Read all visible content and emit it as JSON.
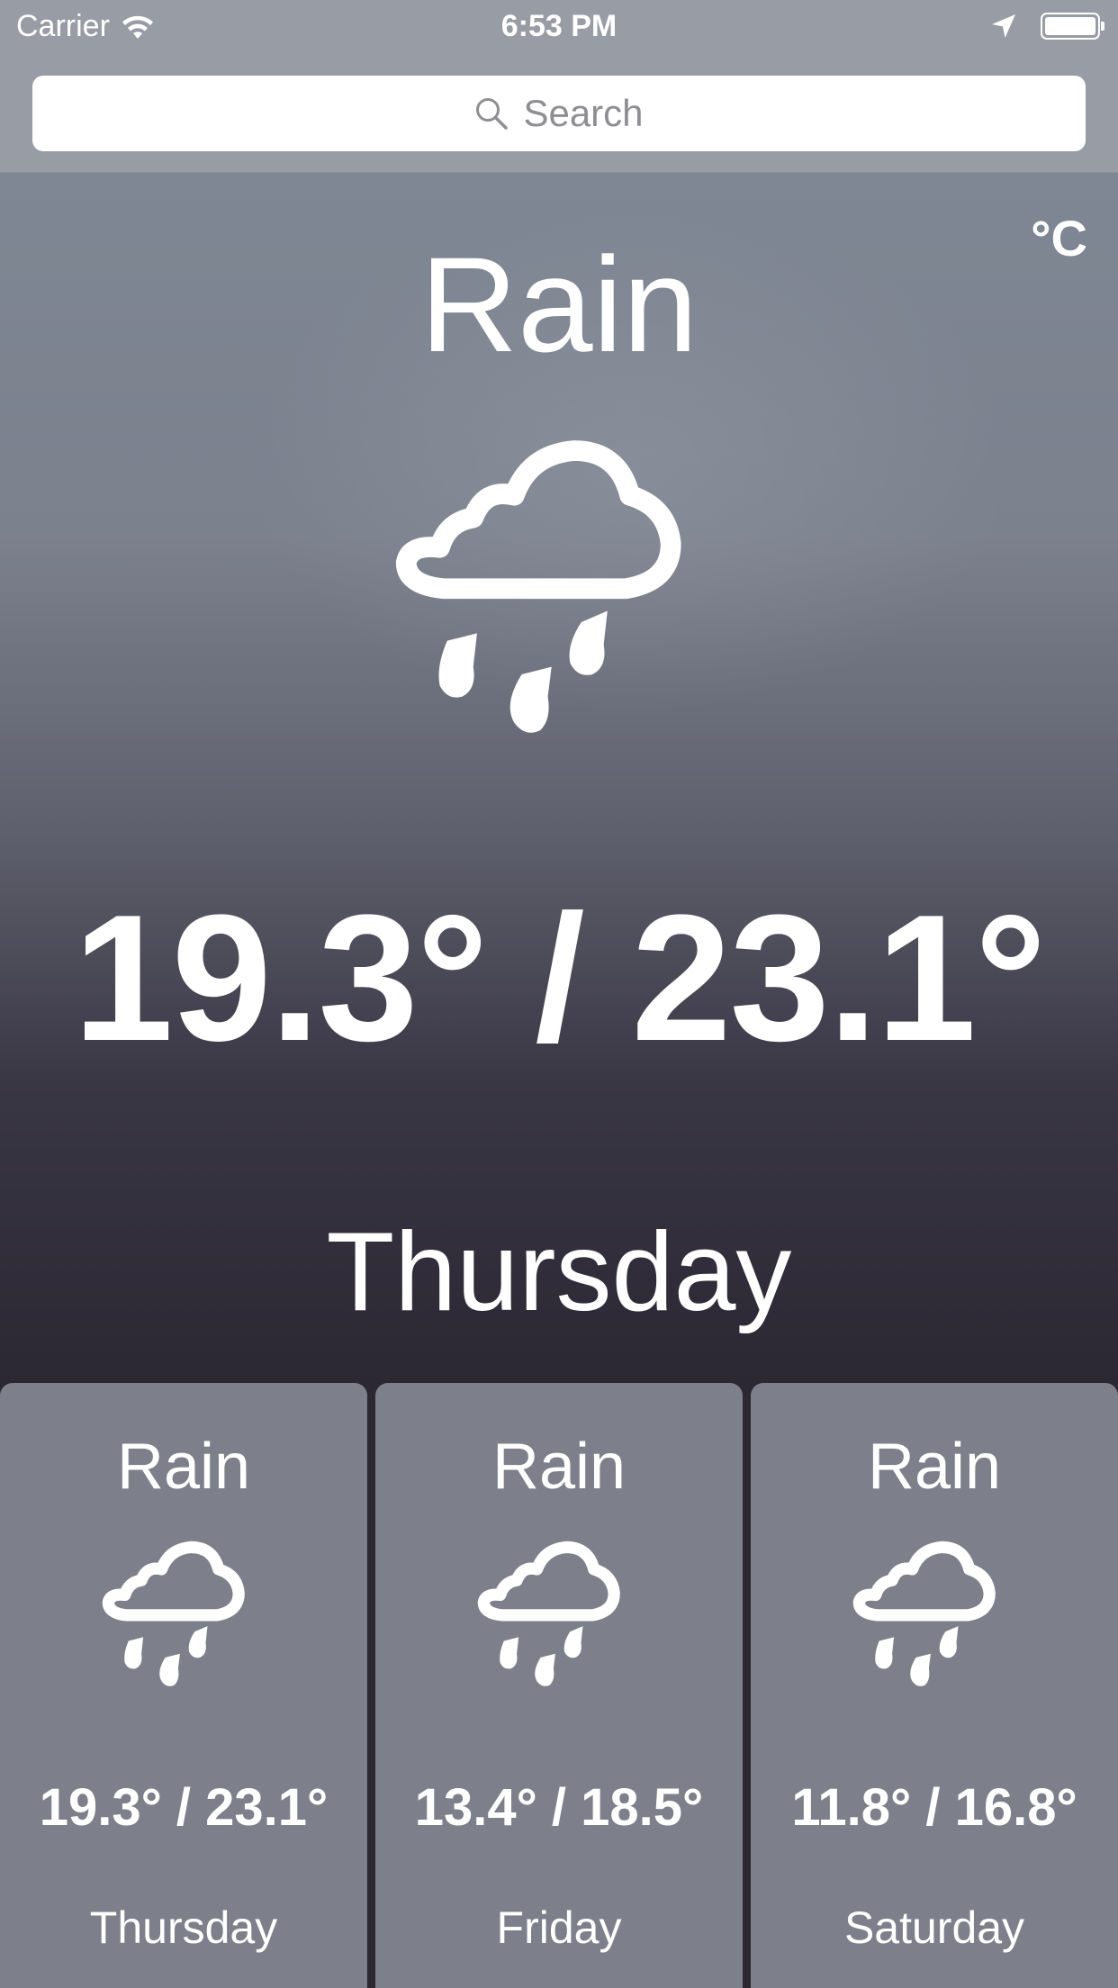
{
  "status_bar": {
    "carrier": "Carrier",
    "time": "6:53 PM"
  },
  "search": {
    "placeholder": "Search"
  },
  "current": {
    "unit": "°C",
    "condition": "Rain",
    "temps": "19.3° / 23.1°",
    "day": "Thursday",
    "icon": "rain-cloud-icon"
  },
  "forecast": [
    {
      "condition": "Rain",
      "temps": "19.3° / 23.1°",
      "day": "Thursday",
      "icon": "rain-cloud-icon"
    },
    {
      "condition": "Rain",
      "temps": "13.4° / 18.5°",
      "day": "Friday",
      "icon": "rain-cloud-icon"
    },
    {
      "condition": "Rain",
      "temps": "11.8° / 16.8°",
      "day": "Saturday",
      "icon": "rain-cloud-icon"
    }
  ],
  "colors": {
    "topbar": "#979ca5",
    "card": "#7d808b",
    "background_dark": "#2b2733",
    "text": "#ffffff"
  }
}
